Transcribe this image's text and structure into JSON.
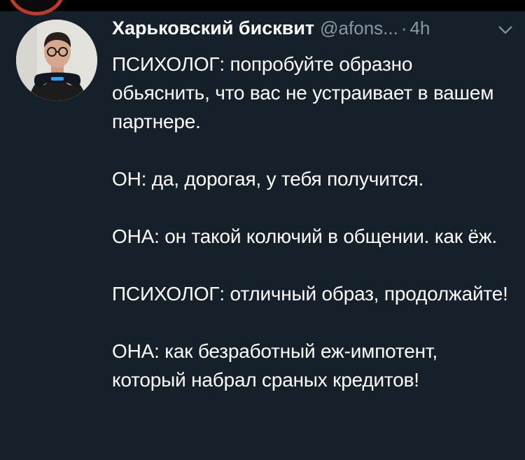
{
  "author": {
    "display_name": "Харьковский бисквит",
    "handle": "@afons...",
    "separator": "·",
    "time": "4h"
  },
  "icons": {
    "avatar": "user-avatar",
    "menu": "chevron-down-icon",
    "top_avatar": "previous-avatar-remnant"
  },
  "colors": {
    "background": "#15202b",
    "secondary_text": "#8899a6",
    "primary_text": "#ffffff"
  },
  "tweet": {
    "paragraphs": [
      "ПСИХОЛОГ: попробуйте образно обьяснить, что вас не устраивает в вашем партнере.",
      "ОН: да, дорогая, у тебя получится.",
      "ОНА: он такой колючий в общении. как ёж.",
      "ПСИХОЛОГ: отличный образ, продолжайте!",
      "ОНА: как безработный еж-импотент, который набрал сраных кредитов!"
    ]
  }
}
